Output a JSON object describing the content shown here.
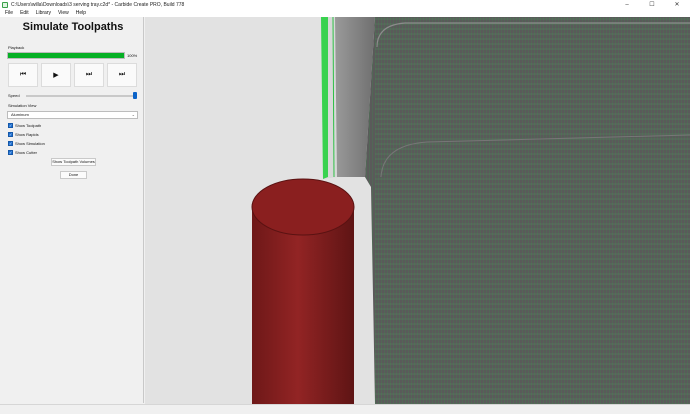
{
  "window": {
    "title": "C:\\Users\\willa\\Downloads\\3 serving tray.c2d* - Carbide Create PRO, Build 778",
    "controls": [
      "–",
      "☐",
      "✕"
    ]
  },
  "menu": [
    "File",
    "Edit",
    "Library",
    "View",
    "Help"
  ],
  "panel": {
    "title": "Simulate Toolpaths",
    "playback_label": "Playback",
    "progress_value": 1.0,
    "progress_text": "100%",
    "buttons": [
      {
        "name": "rewind",
        "glyph": "⏮"
      },
      {
        "name": "play",
        "glyph": "▶"
      },
      {
        "name": "step",
        "glyph": "⏭"
      },
      {
        "name": "end",
        "glyph": "⏭"
      }
    ],
    "speed_label": "Speed",
    "speed_value": 1.0,
    "sim_view_label": "Simulation View",
    "sim_view_selected": "Aluminum",
    "checkboxes": [
      {
        "label": "Show Toolpath",
        "checked": true
      },
      {
        "label": "Show Rapids",
        "checked": true
      },
      {
        "label": "Show Simulation",
        "checked": true
      },
      {
        "label": "Show Cutter",
        "checked": true
      }
    ],
    "volumes_button": "Show Toolpath Volumes",
    "done_button": "Done"
  },
  "colors": {
    "accent": "#06b025",
    "cutter": "#8a1f1f",
    "toolpath_green": "#2ed64a",
    "stock_gray": "#5a5a5a"
  }
}
